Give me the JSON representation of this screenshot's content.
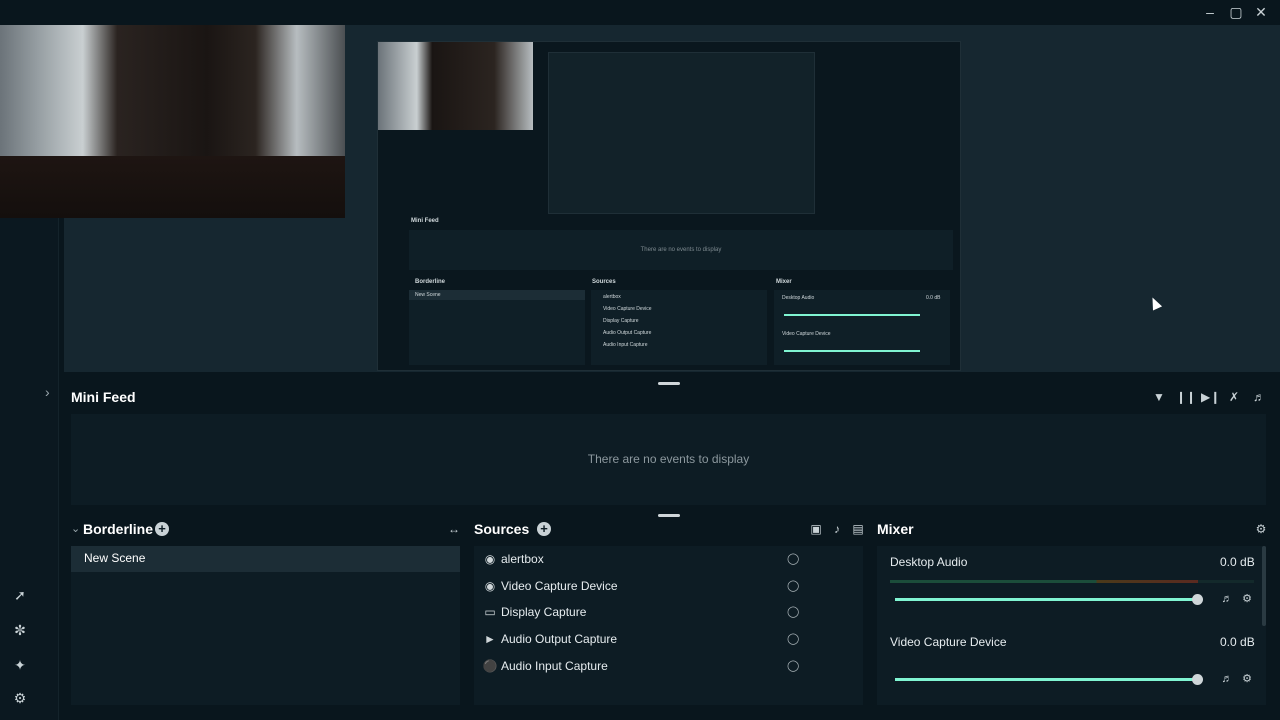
{
  "window": {
    "minimize_icon": "minimize-icon",
    "maximize_icon": "maximize-icon",
    "close_icon": "close-icon"
  },
  "colors": {
    "background": "#09161d",
    "panel": "#0d1c24",
    "accent": "#80f5d2",
    "editor": "#162730"
  },
  "mini_feed": {
    "title": "Mini Feed",
    "empty_text": "There are no events to display",
    "tools": [
      "filter-icon",
      "pause-icon",
      "skip-icon",
      "mute-alerts-icon",
      "volume-icon"
    ]
  },
  "scenes": {
    "title": "Borderline",
    "items": [
      "New Scene"
    ]
  },
  "sources": {
    "title": "Sources",
    "items": [
      {
        "label": "alertbox",
        "icon": "globe-icon"
      },
      {
        "label": "Video Capture Device",
        "icon": "webcam-icon"
      },
      {
        "label": "Display Capture",
        "icon": "monitor-icon"
      },
      {
        "label": "Audio Output Capture",
        "icon": "speaker-icon"
      },
      {
        "label": "Audio Input Capture",
        "icon": "microphone-icon"
      }
    ]
  },
  "mixer": {
    "title": "Mixer",
    "channels": [
      {
        "name": "Desktop Audio",
        "db": "0.0 dB",
        "level": 1.0
      },
      {
        "name": "Video Capture Device",
        "db": "0.0 dB",
        "level": 1.0
      }
    ]
  },
  "left_rail": {
    "icons": [
      "rocket-icon",
      "theme-icon",
      "sparkle-icon",
      "settings-icon"
    ]
  },
  "nested_preview": {
    "mini_feed": "Mini Feed",
    "empty_text": "There are no events to display",
    "scenes_title": "Borderline",
    "scene": "New Scene",
    "sources_title": "Sources",
    "sources": [
      "alertbox",
      "Video Capture Device",
      "Display Capture",
      "Audio Output Capture",
      "Audio Input Capture"
    ],
    "mixer_title": "Mixer",
    "desktop_audio": "Desktop Audio",
    "desktop_db": "0.0 dB",
    "video_capture": "Video Capture Device"
  }
}
